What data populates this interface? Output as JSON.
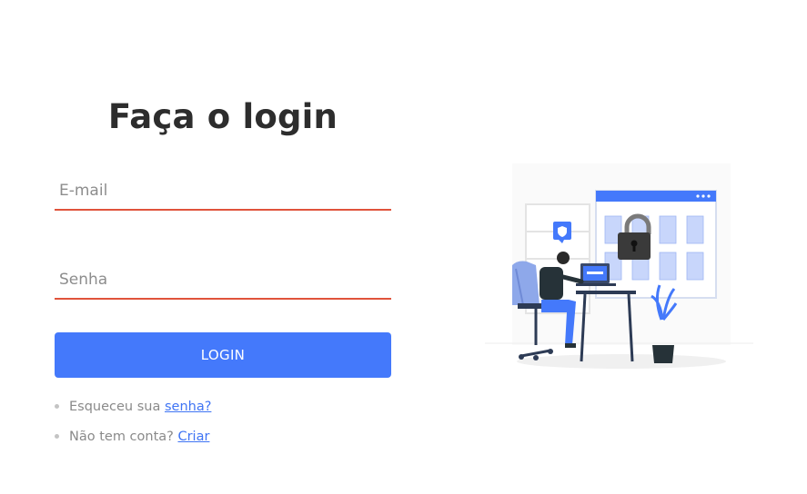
{
  "title": "Faça o login",
  "email": {
    "placeholder": "E-mail"
  },
  "password": {
    "placeholder": "Senha"
  },
  "login_button": "LOGIN",
  "forgot": {
    "text": "Esqueceu sua",
    "link": "senha?"
  },
  "signup": {
    "text": "Não tem conta?",
    "link": "Criar"
  },
  "colors": {
    "primary": "#4479fb",
    "input_underline": "#e0533b",
    "title": "#2d2d2d",
    "muted_text": "#8a8a8a",
    "link": "#3f74f4"
  },
  "illustration": {
    "icons": [
      "padlock-icon",
      "shield-icon",
      "laptop-icon",
      "plant-icon"
    ]
  }
}
